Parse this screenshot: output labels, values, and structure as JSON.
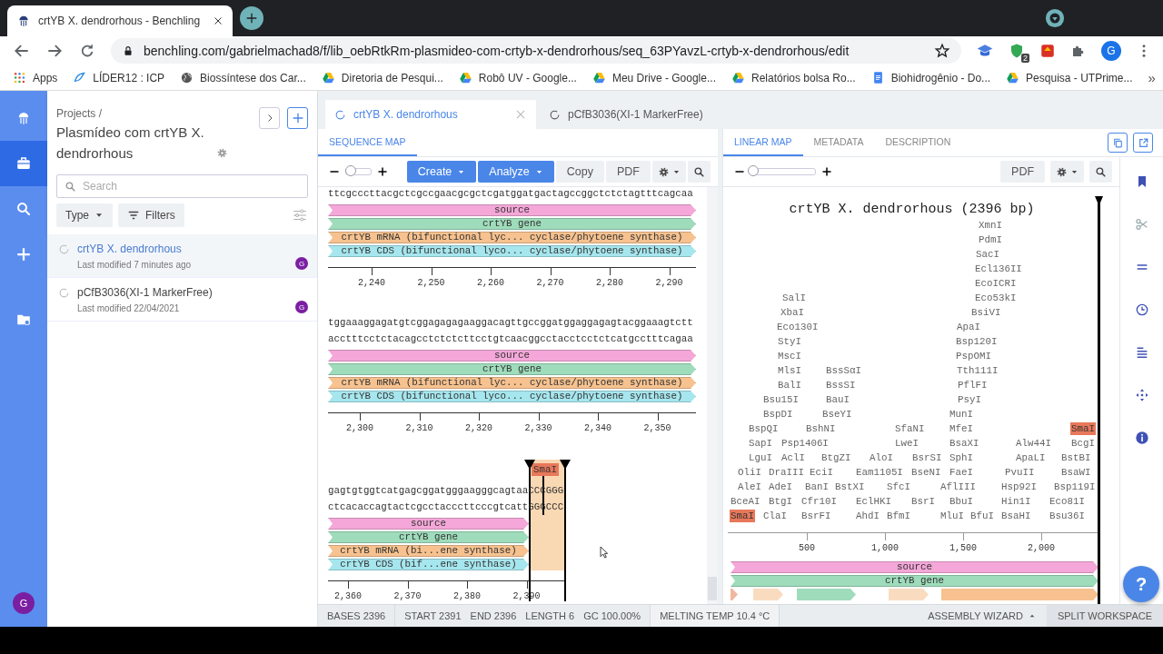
{
  "browser": {
    "tab_title": "crtYB X. dendrorhous - Benchling",
    "url": "benchling.com/gabrielmachad8/f/lib_oebRtkRm-plasmideo-com-crtyb-x-dendrorhous/seq_63PYavzL-crtyb-x-dendrorhous/edit",
    "extension_badge": "2",
    "profile_initial": "G",
    "bookmarks": [
      {
        "kind": "apps",
        "label": "Apps"
      },
      {
        "kind": "logo",
        "label": "LÍDER12 : ICP"
      },
      {
        "kind": "globe",
        "label": "Biossíntese dos Car..."
      },
      {
        "kind": "drive",
        "label": "Diretoria de Pesqui..."
      },
      {
        "kind": "drive",
        "label": "Robô UV - Google..."
      },
      {
        "kind": "drive",
        "label": "Meu Drive - Google..."
      },
      {
        "kind": "drive",
        "label": "Relatórios bolsa Ro..."
      },
      {
        "kind": "doc",
        "label": "Biohidrogênio - Do..."
      },
      {
        "kind": "drive",
        "label": "Pesquisa - UTPrime..."
      }
    ],
    "bookmarks_more": "»"
  },
  "nav_rail": {
    "items": [
      {
        "kind": "logo",
        "selected": false
      },
      {
        "kind": "projects",
        "selected": true
      },
      {
        "kind": "search",
        "selected": false
      },
      {
        "kind": "create",
        "selected": false
      },
      {
        "kind": "folder",
        "selected": false
      }
    ],
    "user_initial": "G"
  },
  "project_panel": {
    "breadcrumb": "Projects /",
    "title": "Plasmídeo com crtYB X. dendrorhous",
    "search": {
      "placeholder": "Search"
    },
    "type_filter": "Type",
    "filters_button": "Filters",
    "items": [
      {
        "name": "crtYB X. dendrorhous",
        "modified": "Last modified 7 minutes ago",
        "owner_initial": "G",
        "selected": true
      },
      {
        "name": "pCfB3036(XI-1 MarkerFree)",
        "modified": "Last modified 22/04/2021",
        "owner_initial": "G",
        "selected": false
      }
    ]
  },
  "document_tabs": [
    {
      "label": "crtYB X. dendrorhous",
      "selected": true
    },
    {
      "label": "pCfB3036(XI-1 MarkerFree)",
      "selected": false
    }
  ],
  "sequence_pane": {
    "tabs": [
      {
        "label": "SEQUENCE MAP",
        "selected": true
      }
    ],
    "zoom": {
      "level": 0.2
    },
    "buttons": [
      {
        "kind": "primary",
        "label": "Create"
      },
      {
        "kind": "primary",
        "label": "Analyze"
      },
      {
        "kind": "plain",
        "label": "Copy"
      },
      {
        "kind": "plain",
        "label": "PDF"
      }
    ],
    "blocks": [
      {
        "kind": "full",
        "strands": [
          "ttcgcccttacgctcgccgaacgcgctcgatggatgactagccggctctctagtttcagcaa"
        ],
        "features": [
          {
            "label": "source",
            "color": "#f4a7d8"
          },
          {
            "label": "crtYB gene",
            "color": "#9edcbb"
          },
          {
            "label": "crtYB mRNA (bifunctional lyc... cyclase/phytoene synthase)",
            "color": "#f7c28f"
          },
          {
            "label": "crtYB CDS (bifunctional lyco... cyclase/phytoene synthase)",
            "color": "#a6e6ee"
          }
        ],
        "ticks": [
          "2,240",
          "2,250",
          "2,260",
          "2,270",
          "2,280",
          "2,290"
        ]
      },
      {
        "kind": "full",
        "strands": [
          "tggaaaggagatgtcggagagagaaggacagttgccggatggaggagagtacggaaagtctt",
          "acctttcctctacagcctctctcttcctgtcaacggcctacctcctctcatgcctttcagaa"
        ],
        "features": [
          {
            "label": "source",
            "color": "#f4a7d8"
          },
          {
            "label": "crtYB gene",
            "color": "#9edcbb"
          },
          {
            "label": "crtYB mRNA (bifunctional lyc... cyclase/phytoene synthase)",
            "color": "#f7c28f"
          },
          {
            "label": "crtYB CDS (bifunctional lyco... cyclase/phytoene synthase)",
            "color": "#a6e6ee"
          }
        ],
        "ticks": [
          "2,300",
          "2,310",
          "2,320",
          "2,330",
          "2,340",
          "2,350"
        ]
      },
      {
        "kind": "end",
        "selection_label": "SmaI",
        "strands": [
          "gagtgtggtcatgagcggatgggaagggcagtaaCCCGGG",
          "ctcacaccagtactcgcctacccttcccgtcattGGGCCC"
        ],
        "features": [
          {
            "label": "source",
            "color": "#f4a7d8"
          },
          {
            "label": "crtYB gene",
            "color": "#9edcbb"
          },
          {
            "label": "crtYB mRNA (bi...ene synthase)",
            "color": "#f7c28f"
          },
          {
            "label": "crtYB CDS (bif...ene synthase)",
            "color": "#a6e6ee"
          }
        ],
        "ticks": [
          "2,360",
          "2,370",
          "2,380",
          "2,390"
        ]
      }
    ]
  },
  "map_pane": {
    "tabs": [
      {
        "label": "LINEAR MAP",
        "selected": true
      },
      {
        "label": "METADATA",
        "selected": false
      },
      {
        "label": "DESCRIPTION",
        "selected": false
      }
    ],
    "zoom": {
      "level": 0.03
    },
    "pdf_button": "PDF",
    "title": "crtYB X. dendrorhous (2396 bp)",
    "enzyme_rows": [
      [
        {
          "label": "XmnI",
          "highlighted": false
        }
      ],
      [
        {
          "label": "PdmI",
          "highlighted": false
        }
      ],
      [
        {
          "label": "SacI",
          "highlighted": false
        }
      ],
      [
        {
          "label": "Ecl136II",
          "highlighted": false
        }
      ],
      [
        {
          "label": "EcoICRI",
          "highlighted": false
        }
      ],
      [
        {
          "label": "SalI",
          "highlighted": false
        },
        {
          "label": "Eco53kI",
          "highlighted": false
        }
      ],
      [
        {
          "label": "XbaI",
          "highlighted": false
        },
        {
          "label": "BsiVI",
          "highlighted": false
        }
      ],
      [
        {
          "label": "Eco130I",
          "highlighted": false
        },
        {
          "label": "ApaI",
          "highlighted": false
        }
      ],
      [
        {
          "label": "StyI",
          "highlighted": false
        },
        {
          "label": "Bsp120I",
          "highlighted": false
        }
      ],
      [
        {
          "label": "MscI",
          "highlighted": false
        },
        {
          "label": "PspOMI",
          "highlighted": false
        }
      ],
      [
        {
          "label": "MlsI",
          "highlighted": false
        },
        {
          "label": "BssSαI",
          "highlighted": false
        },
        {
          "label": "Tth111I",
          "highlighted": false
        }
      ],
      [
        {
          "label": "BalI",
          "highlighted": false
        },
        {
          "label": "BssSI",
          "highlighted": false
        },
        {
          "label": "PflFI",
          "highlighted": false
        }
      ],
      [
        {
          "label": "Bsu15I",
          "highlighted": false
        },
        {
          "label": "BauI",
          "highlighted": false
        },
        {
          "label": "PsyI",
          "highlighted": false
        }
      ],
      [
        {
          "label": "BspDI",
          "highlighted": false
        },
        {
          "label": "BseYI",
          "highlighted": false
        },
        {
          "label": "MunI",
          "highlighted": false
        }
      ],
      [
        {
          "label": "BspQI",
          "highlighted": false
        },
        {
          "label": "BshNI",
          "highlighted": false
        },
        {
          "label": "SfaNI",
          "highlighted": false
        },
        {
          "label": "MfeI",
          "highlighted": false
        },
        {
          "label": "SmaI",
          "highlighted": true
        }
      ],
      [
        {
          "label": "SapI",
          "highlighted": false
        },
        {
          "label": "Psp1406I",
          "highlighted": false
        },
        {
          "label": "LweI",
          "highlighted": false
        },
        {
          "label": "BsaXI",
          "highlighted": false
        },
        {
          "label": "Alw44I",
          "highlighted": false
        },
        {
          "label": "BcgI",
          "highlighted": false
        }
      ],
      [
        {
          "label": "LguI",
          "highlighted": false
        },
        {
          "label": "AclI",
          "highlighted": false
        },
        {
          "label": "BtgZI",
          "highlighted": false
        },
        {
          "label": "AloI",
          "highlighted": false
        },
        {
          "label": "BsrSI",
          "highlighted": false
        },
        {
          "label": "SphI",
          "highlighted": false
        },
        {
          "label": "ApaLI",
          "highlighted": false
        },
        {
          "label": "BstBI",
          "highlighted": false
        }
      ],
      [
        {
          "label": "OliI",
          "highlighted": false
        },
        {
          "label": "DraIII",
          "highlighted": false
        },
        {
          "label": "EciI",
          "highlighted": false
        },
        {
          "label": "Eam1105I",
          "highlighted": false
        },
        {
          "label": "BseNI",
          "highlighted": false
        },
        {
          "label": "FaeI",
          "highlighted": false
        },
        {
          "label": "PvuII",
          "highlighted": false
        },
        {
          "label": "BsaWI",
          "highlighted": false
        }
      ],
      [
        {
          "label": "AleI",
          "highlighted": false
        },
        {
          "label": "AdeI",
          "highlighted": false
        },
        {
          "label": "BanI",
          "highlighted": false
        },
        {
          "label": "BstXI",
          "highlighted": false
        },
        {
          "label": "SfcI",
          "highlighted": false
        },
        {
          "label": "AflIII",
          "highlighted": false
        },
        {
          "label": "Hsp92I",
          "highlighted": false
        },
        {
          "label": "Bsp119I",
          "highlighted": false
        }
      ],
      [
        {
          "label": "BceAI",
          "highlighted": false
        },
        {
          "label": "BtgI",
          "highlighted": false
        },
        {
          "label": "Cfr10I",
          "highlighted": false
        },
        {
          "label": "EclHKI",
          "highlighted": false
        },
        {
          "label": "BsrI",
          "highlighted": false
        },
        {
          "label": "BbuI",
          "highlighted": false
        },
        {
          "label": "Hin1I",
          "highlighted": false
        },
        {
          "label": "Eco81I",
          "highlighted": false
        }
      ],
      [
        {
          "label": "SmaI",
          "highlighted": true
        },
        {
          "label": "ClaI",
          "highlighted": false
        },
        {
          "label": "BsrFI",
          "highlighted": false
        },
        {
          "label": "AhdI",
          "highlighted": false
        },
        {
          "label": "BfmI",
          "highlighted": false
        },
        {
          "label": "MluI",
          "highlighted": false
        },
        {
          "label": "BfuI",
          "highlighted": false
        },
        {
          "label": "BsaHI",
          "highlighted": false
        },
        {
          "label": "Bsu36I",
          "highlighted": false
        }
      ]
    ],
    "axis_ticks": [
      "500",
      "1,000",
      "1,500",
      "2,000"
    ],
    "features": [
      {
        "label": "source",
        "color": "#f4a7d8"
      },
      {
        "label": "crtYB gene",
        "color": "#9edcbb"
      }
    ],
    "partial_features": [
      {
        "color": "#f0b8a0"
      },
      {
        "color": "#f9dcc0"
      },
      {
        "color": "#9edcbb"
      },
      {
        "color": "#f9dcc0"
      },
      {
        "color": "#f7c28f"
      }
    ],
    "help_button": "?"
  },
  "status_bar": {
    "bases": "BASES 2396",
    "selection": [
      "START 2391",
      "END 2396",
      "LENGTH 6",
      "GC 100.00%"
    ],
    "melting_temp": "MELTING TEMP 10.4 °C",
    "assembly_wizard": "ASSEMBLY WIZARD",
    "split_workspace": "SPLIT WORKSPACE"
  }
}
